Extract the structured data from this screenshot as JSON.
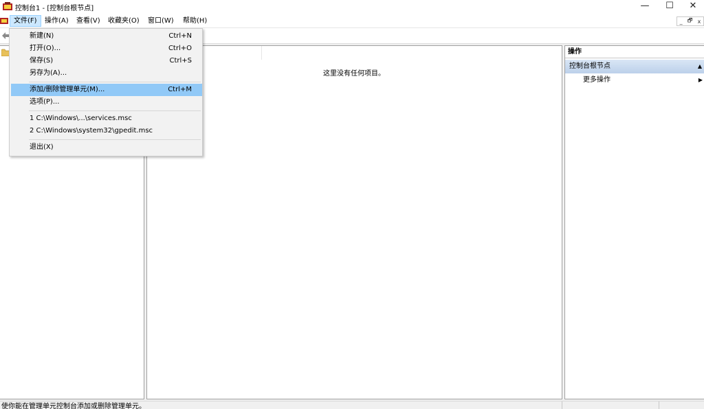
{
  "window": {
    "title": "控制台1 - [控制台根节点]",
    "minimize": "—",
    "maximize": "☐",
    "close": "✕"
  },
  "menubar": {
    "items": [
      {
        "label": "文件(F)"
      },
      {
        "label": "操作(A)"
      },
      {
        "label": "查看(V)"
      },
      {
        "label": "收藏夹(O)"
      },
      {
        "label": "窗口(W)"
      },
      {
        "label": "帮助(H)"
      }
    ],
    "mdi_min": "_",
    "mdi_restore": "🗗",
    "mdi_close": "x"
  },
  "file_menu": {
    "items": [
      {
        "label": "新建(N)",
        "shortcut": "Ctrl+N"
      },
      {
        "label": "打开(O)...",
        "shortcut": "Ctrl+O"
      },
      {
        "label": "保存(S)",
        "shortcut": "Ctrl+S"
      },
      {
        "label": "另存为(A)...",
        "shortcut": ""
      },
      {
        "label": "添加/删除管理单元(M)...",
        "shortcut": "Ctrl+M"
      },
      {
        "label": "选项(P)...",
        "shortcut": ""
      },
      {
        "label": "1 C:\\Windows\\...\\services.msc",
        "shortcut": ""
      },
      {
        "label": "2 C:\\Windows\\system32\\gpedit.msc",
        "shortcut": ""
      },
      {
        "label": "退出(X)",
        "shortcut": ""
      }
    ]
  },
  "center": {
    "empty_message": "这里没有任何项目。"
  },
  "actions": {
    "title": "操作",
    "section": "控制台根节点",
    "more": "更多操作"
  },
  "status": {
    "text": "使你能在管理单元控制台添加或删除管理单元。"
  },
  "colors": {
    "menu_highlight": "#91c9f7",
    "active_menu": "#cce8ff",
    "section_bg": "#c9daef"
  }
}
